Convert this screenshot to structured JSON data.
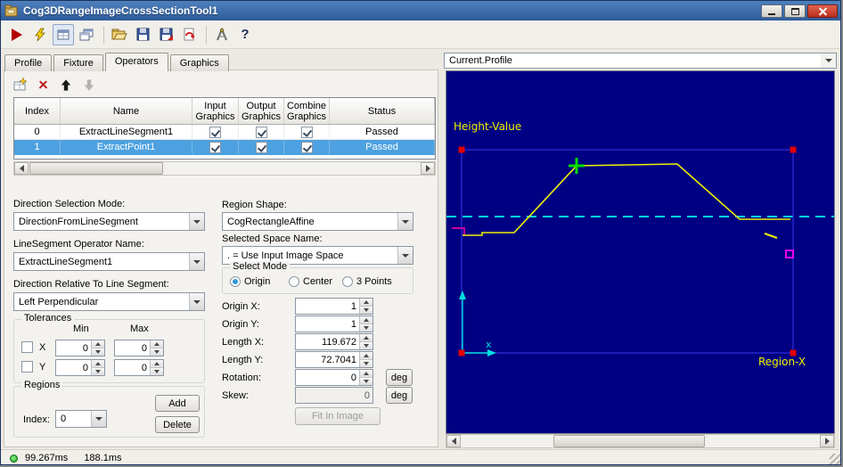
{
  "window": {
    "title": "Cog3DRangeImageCrossSectionTool1"
  },
  "toolbar": {
    "icons": [
      "run-icon",
      "electric-run-icon",
      "result-display-toggle-icon",
      "float-window-icon",
      "open-icon",
      "save-icon",
      "save-station-icon",
      "revert-icon",
      "measure-icon",
      "help-icon"
    ],
    "help_glyph": "?"
  },
  "tabs": {
    "items": [
      {
        "label": "Profile"
      },
      {
        "label": "Fixture"
      },
      {
        "label": "Operators"
      },
      {
        "label": "Graphics"
      }
    ],
    "active": "Operators"
  },
  "operators": {
    "columns": {
      "index": "Index",
      "name": "Name",
      "input": "Input Graphics",
      "output": "Output Graphics",
      "combine": "Combine Graphics",
      "status": "Status"
    },
    "rows": [
      {
        "index": "0",
        "name": "ExtractLineSegment1",
        "input": true,
        "output": true,
        "combine": true,
        "status": "Passed",
        "selected": false
      },
      {
        "index": "1",
        "name": "ExtractPoint1",
        "input": true,
        "output": true,
        "combine": true,
        "status": "Passed",
        "selected": true
      }
    ]
  },
  "controls": {
    "direction_mode_label": "Direction Selection Mode:",
    "direction_mode_value": "DirectionFromLineSegment",
    "operator_name_label": "LineSegment Operator Name:",
    "operator_name_value": "ExtractLineSegment1",
    "direction_relative_label": "Direction Relative To Line Segment:",
    "direction_relative_value": "Left Perpendicular",
    "tolerances": {
      "title": "Tolerances",
      "min": "Min",
      "max": "Max",
      "x": "X",
      "y": "Y",
      "x_min": "0",
      "x_max": "0",
      "y_min": "0",
      "y_max": "0"
    },
    "regions": {
      "title": "Regions",
      "index_label": "Index:",
      "index_value": "0",
      "add": "Add",
      "delete": "Delete"
    }
  },
  "region": {
    "shape_label": "Region Shape:",
    "shape_value": "CogRectangleAffine",
    "space_label": "Selected Space Name:",
    "space_value": ". = Use Input Image Space",
    "select_mode": {
      "title": "Select Mode",
      "origin": "Origin",
      "center": "Center",
      "three_points": "3 Points"
    },
    "origin_x_label": "Origin X:",
    "origin_x": "1",
    "origin_y_label": "Origin Y:",
    "origin_y": "1",
    "length_x_label": "Length X:",
    "length_x": "119.672",
    "length_y_label": "Length Y:",
    "length_y": "72.7041",
    "rotation_label": "Rotation:",
    "rotation": "0",
    "skew_label": "Skew:",
    "skew": "0",
    "deg": "deg",
    "fit_button": "Fit In Image"
  },
  "profile_view": {
    "selector": "Current.Profile",
    "axis_label": "Height-Value",
    "region_label": "Region-X",
    "x_label": "x",
    "trace_points": "18,184 40,184 40,181 76,181 146,106 259,104 329,166 386,166",
    "colors": {
      "background": "#000082",
      "trace": "#f0f000",
      "region": "#3030e0",
      "cursor": "#00dd00",
      "dashed": "#00d8e0",
      "marker": "#ee00ee"
    }
  },
  "status_bar": {
    "run_time": "99.267ms",
    "total_time": "188.1ms"
  }
}
